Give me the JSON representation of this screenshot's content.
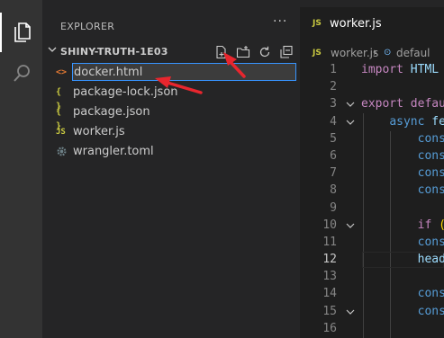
{
  "sidebar": {
    "title": "EXPLORER",
    "more_label": "···",
    "folder_name": "SHINY-TRUTH-1E03",
    "actions": [
      {
        "name": "new-file-icon"
      },
      {
        "name": "new-folder-icon"
      },
      {
        "name": "refresh-icon"
      },
      {
        "name": "collapse-all-icon"
      }
    ],
    "new_file_input_value": "docker.html",
    "files": [
      {
        "label": "package-lock.json",
        "icon": "{ }",
        "color": "#cbcb41"
      },
      {
        "label": "package.json",
        "icon": "{ }",
        "color": "#cbcb41"
      },
      {
        "label": "worker.js",
        "icon": "JS",
        "color": "#cbcb41"
      },
      {
        "label": "wrangler.toml",
        "icon": "gear",
        "color": "#6d8086"
      }
    ]
  },
  "editor": {
    "tab_icon": "JS",
    "tab_name": "worker.js",
    "breadcrumb_file": "worker.js",
    "breadcrumb_sep": "›",
    "breadcrumb_symbol": "defaul"
  },
  "code_lines": [
    {
      "n": "1",
      "text": "import HTML"
    },
    {
      "n": "2",
      "text": ""
    },
    {
      "n": "3",
      "text": "export defau"
    },
    {
      "n": "4",
      "text": "async fe"
    },
    {
      "n": "5",
      "text": "cons"
    },
    {
      "n": "6",
      "text": "cons"
    },
    {
      "n": "7",
      "text": "cons"
    },
    {
      "n": "8",
      "text": "cons"
    },
    {
      "n": "9",
      "text": ""
    },
    {
      "n": "10",
      "text": "if ("
    },
    {
      "n": "11",
      "text": "cons"
    },
    {
      "n": "12",
      "text": "head"
    },
    {
      "n": "13",
      "text": ""
    },
    {
      "n": "14",
      "text": "cons"
    },
    {
      "n": "15",
      "text": "cons"
    },
    {
      "n": "16",
      "text": ""
    }
  ],
  "colors": {
    "accent_border": "#3794ff",
    "annotation": "#e8262e",
    "json_icon": "#cbcb41",
    "html_icon": "#e37933"
  }
}
